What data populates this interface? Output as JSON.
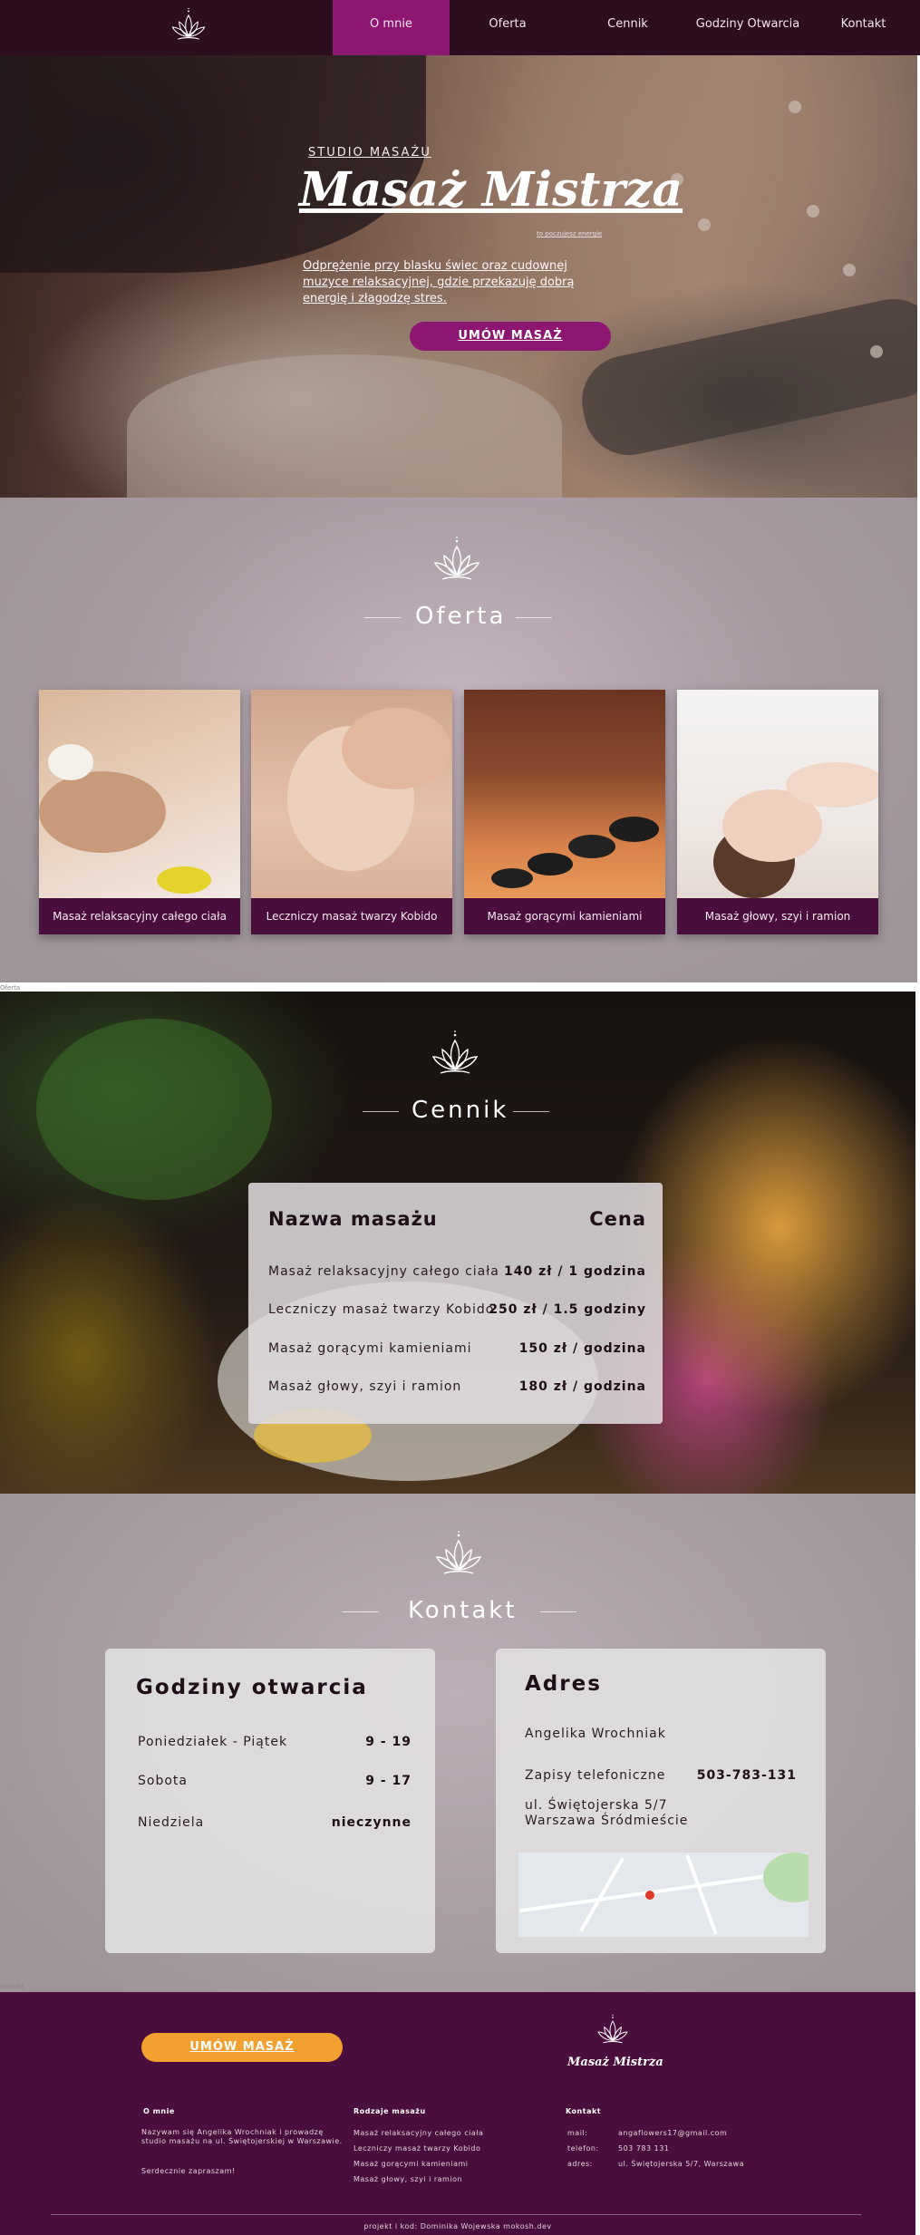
{
  "nav": {
    "items": [
      {
        "label": "O mnie",
        "active": true
      },
      {
        "label": "Oferta",
        "active": false
      },
      {
        "label": "Cennik",
        "active": false
      },
      {
        "label": "Godziny Otwarcia",
        "active": false
      },
      {
        "label": "Kontakt",
        "active": false
      }
    ],
    "logo_icon": "lotus-icon"
  },
  "hero": {
    "eyebrow": "STUDIO MASAŻU",
    "title": "Masaż Mistrza",
    "tiny_link": "to poczujesz energie",
    "description": "Odprężenie przy blasku świec oraz cudownej muzyce relaksacyjnej, gdzie przekazuję dobrą energię i złagodzę stres.",
    "cta": "UMÓW MASAŻ"
  },
  "oferta": {
    "title": "Oferta",
    "cards": [
      {
        "label": "Masaż relaksacyjny całego ciała"
      },
      {
        "label": "Leczniczy masaż twarzy Kobido"
      },
      {
        "label": "Masaż gorącymi kamieniami"
      },
      {
        "label": "Masaż głowy, szyi i ramion"
      }
    ],
    "anchor_label": "Oferta"
  },
  "cennik": {
    "title": "Cennik",
    "header_name": "Nazwa masażu",
    "header_price": "Cena",
    "rows": [
      {
        "name": "Masaż relaksacyjny całego ciała",
        "price": "140 zł / 1 godzina"
      },
      {
        "name": "Leczniczy masaż twarzy Kobido",
        "price": "250 zł / 1.5 godziny"
      },
      {
        "name": "Masaż gorącymi kamieniami",
        "price": "150 zł / godzina"
      },
      {
        "name": "Masaż głowy, szyi i ramion",
        "price": "180 zł / godzina"
      }
    ]
  },
  "kontakt": {
    "title": "Kontakt",
    "hours": {
      "title": "Godziny otwarcia",
      "rows": [
        {
          "day": "Poniedziałek - Piątek",
          "time": "9 - 19"
        },
        {
          "day": "Sobota",
          "time": "9 - 17"
        },
        {
          "day": "Niedziela",
          "time": "nieczynne"
        }
      ]
    },
    "address": {
      "title": "Adres",
      "name": "Angelika Wrochniak",
      "phone_label": "Zapisy telefoniczne",
      "phone": "503-783-131",
      "street": "ul. Świętojerska 5/7",
      "city": "Warszawa Śródmieście"
    },
    "anchor_label": "Kontakt"
  },
  "footer": {
    "cta": "UMÓW MASAŻ",
    "brand": "Masaż Mistrza",
    "about": {
      "title": "O mnie",
      "text": "Nazywam się Angelika Wrochniak i prowadzę studio masażu na ul. Świętojerskiej w Warszawie.",
      "greeting": "Serdecznie zapraszam!"
    },
    "services": {
      "title": "Rodzaje masażu",
      "items": [
        "Masaż relaksacyjny całego ciała",
        "Leczniczy masaż twarzy Kobido",
        "Masaż gorącymi kamieniami",
        "Masaż głowy, szyi i ramion"
      ]
    },
    "contact": {
      "title": "Kontakt",
      "mail_label": "mail:",
      "mail": "angaflowers17@gmail.com",
      "phone_label": "telefon:",
      "phone": "503 783 131",
      "address_label": "adres:",
      "address": "ul. Świętojerska 5/7, Warszawa"
    },
    "credit": "projekt i kod: Dominika Wojewska mokosh.dev"
  },
  "colors": {
    "nav_bg": "#2c0e1e",
    "accent": "#8d1672",
    "card_caption_bg": "#4a0e3c",
    "footer_bg": "#4a0e3c",
    "orange": "#f2a030"
  }
}
